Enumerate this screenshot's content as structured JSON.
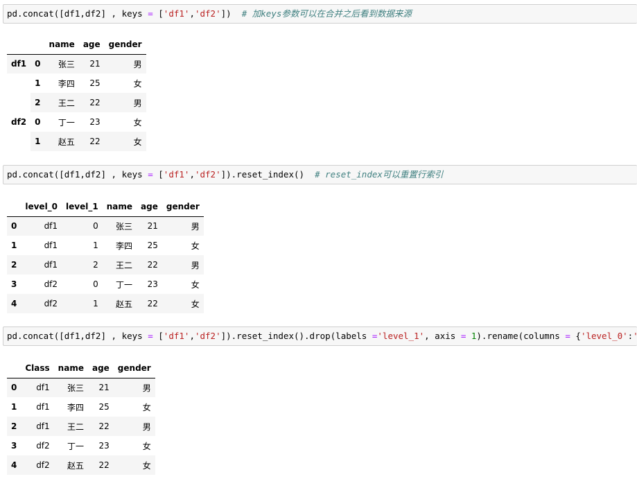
{
  "cells": [
    {
      "code_tokens": [
        {
          "t": "pd.concat([df1,df2] , keys ",
          "c": ""
        },
        {
          "t": "=",
          "c": "op"
        },
        {
          "t": " [",
          "c": ""
        },
        {
          "t": "'df1'",
          "c": "str"
        },
        {
          "t": ",",
          "c": ""
        },
        {
          "t": "'df2'",
          "c": "str"
        },
        {
          "t": "])  ",
          "c": ""
        },
        {
          "t": "# 加keys参数可以在合并之后看到数据来源",
          "c": "cm"
        }
      ],
      "columns": [
        "name",
        "age",
        "gender"
      ],
      "rows": [
        {
          "l0": "df1",
          "l1": "0",
          "name": "张三",
          "age": "21",
          "gender": "男"
        },
        {
          "l0": "",
          "l1": "1",
          "name": "李四",
          "age": "25",
          "gender": "女"
        },
        {
          "l0": "",
          "l1": "2",
          "name": "王二",
          "age": "22",
          "gender": "男"
        },
        {
          "l0": "df2",
          "l1": "0",
          "name": "丁一",
          "age": "23",
          "gender": "女"
        },
        {
          "l0": "",
          "l1": "1",
          "name": "赵五",
          "age": "22",
          "gender": "女"
        }
      ]
    },
    {
      "code_tokens": [
        {
          "t": "pd.concat([df1,df2] , keys ",
          "c": ""
        },
        {
          "t": "=",
          "c": "op"
        },
        {
          "t": " [",
          "c": ""
        },
        {
          "t": "'df1'",
          "c": "str"
        },
        {
          "t": ",",
          "c": ""
        },
        {
          "t": "'df2'",
          "c": "str"
        },
        {
          "t": "]).reset_index()  ",
          "c": ""
        },
        {
          "t": "# reset_index可以重置行索引",
          "c": "cm"
        }
      ],
      "columns": [
        "level_0",
        "level_1",
        "name",
        "age",
        "gender"
      ],
      "rows": [
        {
          "idx": "0",
          "level_0": "df1",
          "level_1": "0",
          "name": "张三",
          "age": "21",
          "gender": "男"
        },
        {
          "idx": "1",
          "level_0": "df1",
          "level_1": "1",
          "name": "李四",
          "age": "25",
          "gender": "女"
        },
        {
          "idx": "2",
          "level_0": "df1",
          "level_1": "2",
          "name": "王二",
          "age": "22",
          "gender": "男"
        },
        {
          "idx": "3",
          "level_0": "df2",
          "level_1": "0",
          "name": "丁一",
          "age": "23",
          "gender": "女"
        },
        {
          "idx": "4",
          "level_0": "df2",
          "level_1": "1",
          "name": "赵五",
          "age": "22",
          "gender": "女"
        }
      ]
    },
    {
      "code_tokens": [
        {
          "t": "pd.concat([df1,df2] , keys ",
          "c": ""
        },
        {
          "t": "=",
          "c": "op"
        },
        {
          "t": " [",
          "c": ""
        },
        {
          "t": "'df1'",
          "c": "str"
        },
        {
          "t": ",",
          "c": ""
        },
        {
          "t": "'df2'",
          "c": "str"
        },
        {
          "t": "]).reset_index().drop(labels ",
          "c": ""
        },
        {
          "t": "=",
          "c": "op"
        },
        {
          "t": "'level_1'",
          "c": "str"
        },
        {
          "t": ", axis ",
          "c": ""
        },
        {
          "t": "=",
          "c": "op"
        },
        {
          "t": " ",
          "c": ""
        },
        {
          "t": "1",
          "c": "num"
        },
        {
          "t": ").rename(columns ",
          "c": ""
        },
        {
          "t": "=",
          "c": "op"
        },
        {
          "t": " {",
          "c": ""
        },
        {
          "t": "'level_0'",
          "c": "str"
        },
        {
          "t": ":",
          "c": ""
        },
        {
          "t": "'Class'",
          "c": "str"
        },
        {
          "t": "})",
          "c": ""
        }
      ],
      "columns": [
        "Class",
        "name",
        "age",
        "gender"
      ],
      "rows": [
        {
          "idx": "0",
          "Class": "df1",
          "name": "张三",
          "age": "21",
          "gender": "男"
        },
        {
          "idx": "1",
          "Class": "df1",
          "name": "李四",
          "age": "25",
          "gender": "女"
        },
        {
          "idx": "2",
          "Class": "df1",
          "name": "王二",
          "age": "22",
          "gender": "男"
        },
        {
          "idx": "3",
          "Class": "df2",
          "name": "丁一",
          "age": "23",
          "gender": "女"
        },
        {
          "idx": "4",
          "Class": "df2",
          "name": "赵五",
          "age": "22",
          "gender": "女"
        }
      ]
    }
  ]
}
